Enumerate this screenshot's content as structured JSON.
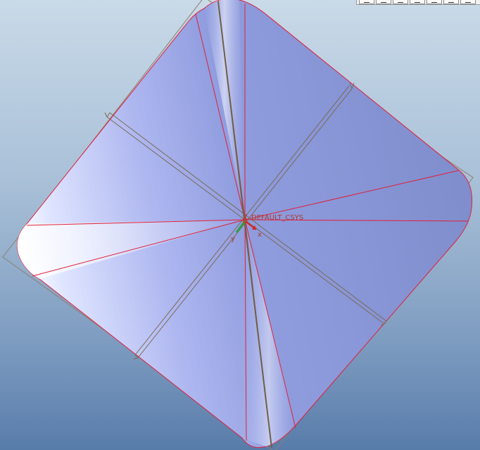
{
  "viewport": {
    "coordinate_system_label": "DEFAULT_CSYS",
    "axis_labels": {
      "x": "x",
      "y": "y"
    }
  },
  "toolbar": {
    "buttons": [
      "view-button-1",
      "view-button-2",
      "view-button-3",
      "view-button-4",
      "view-button-5",
      "view-button-6",
      "view-button-7"
    ]
  },
  "colors": {
    "background_top": "#c9dae8",
    "background_bottom": "#587caa",
    "surface": "#8a97d6",
    "surface_highlight": "#f4f6ff",
    "edge": "#e0203a",
    "datum_plane": "#7a6a55",
    "axis_x": "#e02020",
    "axis_y": "#2ea043"
  }
}
